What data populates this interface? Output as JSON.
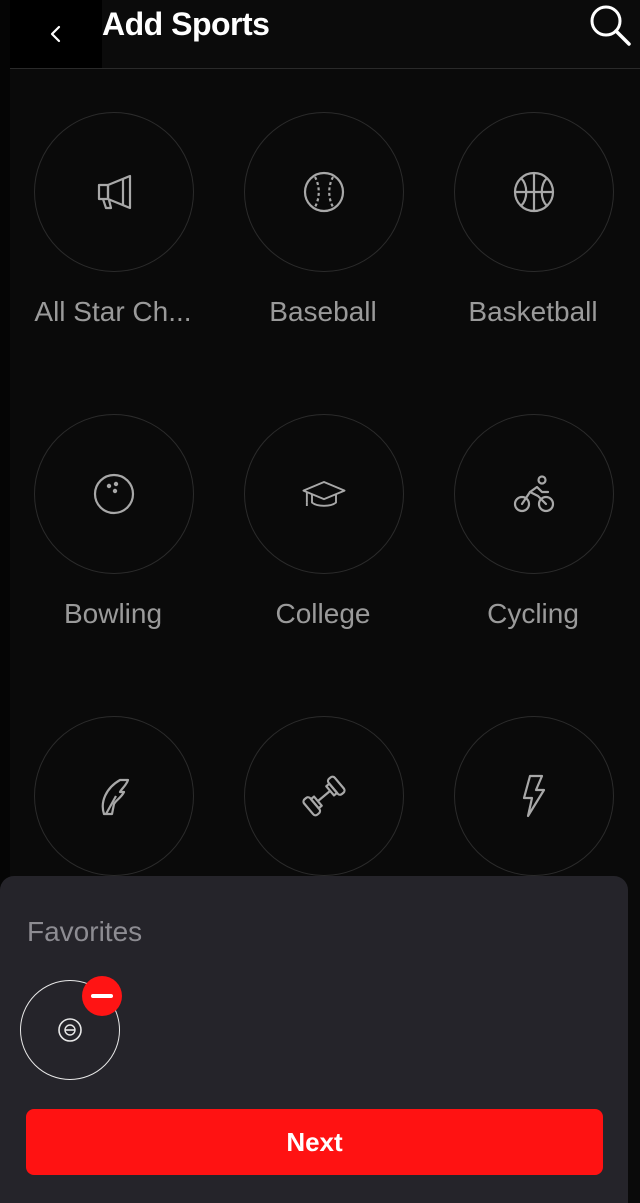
{
  "header": {
    "title": "Add Sports"
  },
  "sports": [
    {
      "label": "All Star Ch...",
      "icon": "megaphone-icon"
    },
    {
      "label": "Baseball",
      "icon": "baseball-icon"
    },
    {
      "label": "Basketball",
      "icon": "basketball-icon"
    },
    {
      "label": "Bowling",
      "icon": "bowling-ball-icon"
    },
    {
      "label": "College",
      "icon": "graduation-cap-icon"
    },
    {
      "label": "Cycling",
      "icon": "cyclist-icon"
    },
    {
      "label": "",
      "icon": "feather-helmet-icon"
    },
    {
      "label": "",
      "icon": "dumbbell-icon"
    },
    {
      "label": "",
      "icon": "lightning-bolt-icon"
    }
  ],
  "favorites": {
    "title": "Favorites",
    "items": [
      {
        "icon": "bowling-ball-icon"
      }
    ]
  },
  "next_label": "Next",
  "colors": {
    "accent": "#ff1212",
    "panel": "#25242a",
    "background": "#0a0a0a"
  }
}
